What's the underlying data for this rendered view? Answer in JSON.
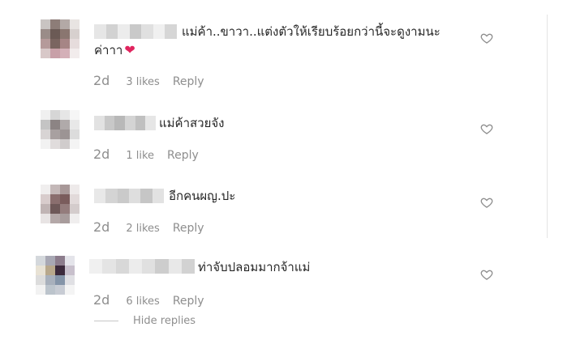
{
  "comments": [
    {
      "text_line1": "แม่ค้า..ขาวา..แต่งตัวให้เรียบร้อยกว่านี้จะดูงามนะ",
      "text_line2": "ค่าาา",
      "time": "2d",
      "likes": "3 likes",
      "reply": "Reply"
    },
    {
      "text_line1": "แม่ค้าสวยจัง",
      "time": "2d",
      "likes": "1 like",
      "reply": "Reply"
    },
    {
      "text_line1": "อีกคนผญ.ปะ",
      "time": "2d",
      "likes": "2 likes",
      "reply": "Reply"
    },
    {
      "text_line1": "ท่าจับปลอมมากจ้าแม่",
      "time": "2d",
      "likes": "6 likes",
      "reply": "Reply"
    }
  ],
  "hide_replies": "Hide replies",
  "icons": {
    "like": "heart-outline-icon",
    "emoji": "red-heart-emoji"
  },
  "colors": {
    "text": "#262626",
    "muted": "#8e8e8e",
    "heart": "#e0245e"
  }
}
